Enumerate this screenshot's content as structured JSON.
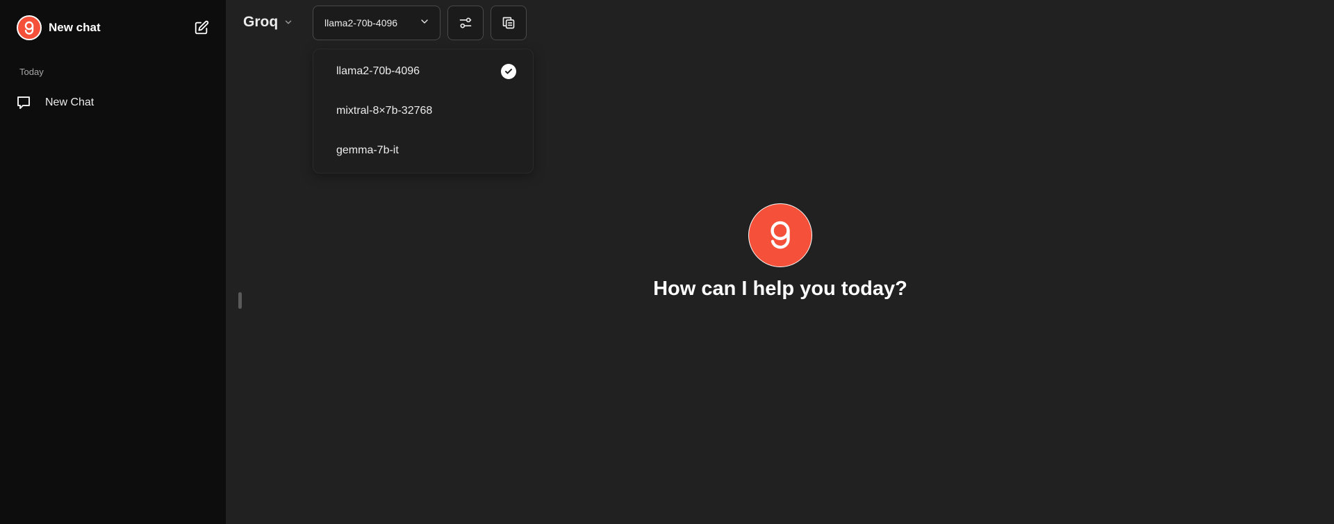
{
  "sidebar": {
    "title": "New chat",
    "section_label": "Today",
    "items": [
      {
        "label": "New Chat",
        "icon": "chat-bubble-icon"
      }
    ]
  },
  "header": {
    "brand": "Groq",
    "model_select": {
      "value": "llama2-70b-4096"
    },
    "buttons": [
      {
        "icon": "sliders-icon"
      },
      {
        "icon": "copy-icon"
      }
    ]
  },
  "dropdown": {
    "options": [
      {
        "label": "llama2-70b-4096",
        "selected": true
      },
      {
        "label": "mixtral-8×7b-32768",
        "selected": false
      },
      {
        "label": "gemma-7b-it",
        "selected": false
      }
    ]
  },
  "main": {
    "greeting": "How can I help you today?"
  },
  "colors": {
    "accent": "#f4503a",
    "sidebar_bg": "#0d0d0d",
    "main_bg": "#212121"
  }
}
